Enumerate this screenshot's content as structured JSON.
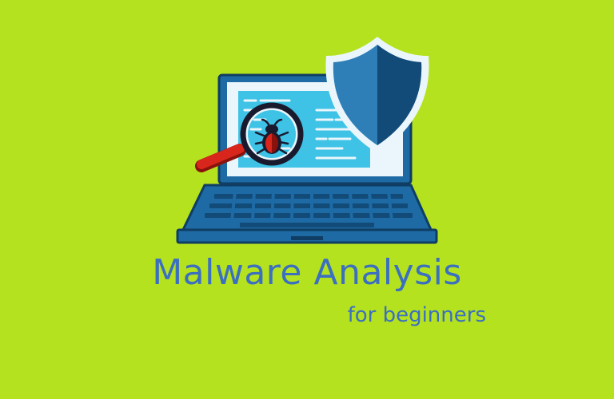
{
  "title": "Malware Analysis",
  "subtitle": "for beginners",
  "colors": {
    "background": "#b5e21e",
    "text": "#3b6fc0",
    "laptop_body": "#1d6aa5",
    "screen": "#3ec3e6",
    "shield_light": "#2e7fb8",
    "shield_dark": "#124a78",
    "magnifier_handle": "#d9261c",
    "bug": "#d9261c"
  },
  "icons": [
    "laptop-icon",
    "shield-icon",
    "magnifier-icon",
    "bug-icon"
  ]
}
